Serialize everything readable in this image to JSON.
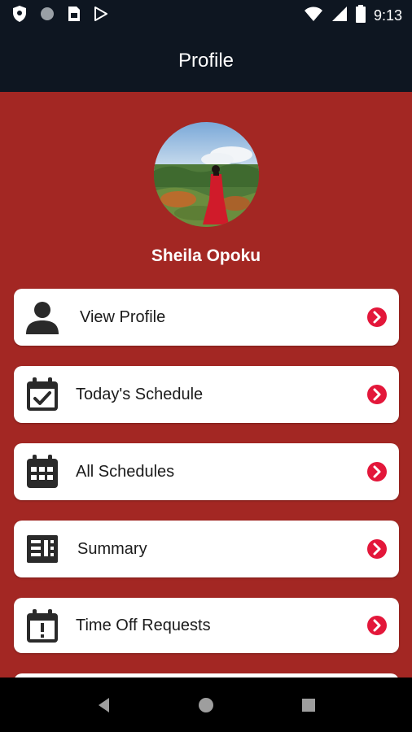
{
  "status_bar": {
    "time": "9:13",
    "left_icons": [
      "shield-icon",
      "circle-icon",
      "sim-card-icon",
      "play-store-icon"
    ],
    "right_icons": [
      "wifi-icon",
      "cell-signal-icon",
      "battery-icon"
    ]
  },
  "app_bar": {
    "title": "Profile"
  },
  "profile": {
    "name": "Sheila Opoku"
  },
  "menu": [
    {
      "label": "View Profile",
      "icon": "user-icon"
    },
    {
      "label": "Today's Schedule",
      "icon": "calendar-check-icon"
    },
    {
      "label": "All Schedules",
      "icon": "calendar-grid-icon"
    },
    {
      "label": "Summary",
      "icon": "summary-icon"
    },
    {
      "label": "Time Off Requests",
      "icon": "calendar-alert-icon"
    }
  ],
  "colors": {
    "background": "#a32723",
    "app_bar": "#0e1621",
    "accent_chevron": "#e3173a",
    "card": "#ffffff"
  },
  "nav_bar": {
    "buttons": [
      "back-icon",
      "home-icon",
      "recents-icon"
    ]
  }
}
